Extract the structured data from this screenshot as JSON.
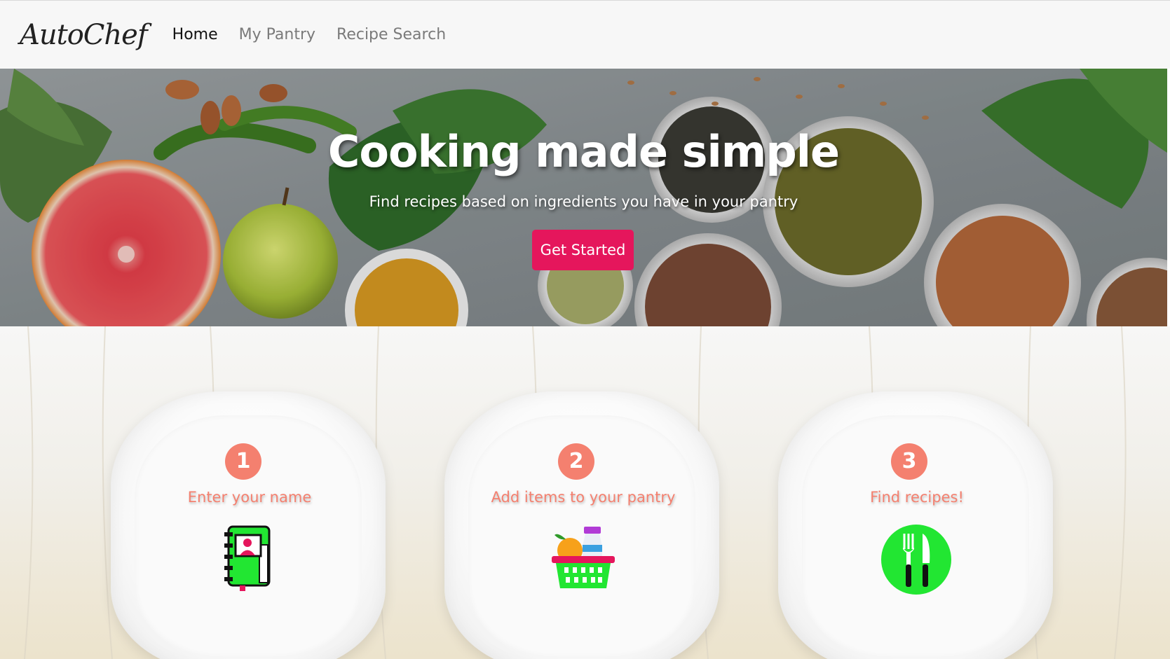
{
  "navbar": {
    "brand": "AutoChef",
    "links": [
      {
        "label": "Home",
        "active": true
      },
      {
        "label": "My Pantry",
        "active": false
      },
      {
        "label": "Recipe Search",
        "active": false
      }
    ]
  },
  "hero": {
    "title": "Cooking made simple",
    "subtitle": "Find recipes based on ingredients you have in your pantry",
    "button_label": "Get Started",
    "button_color": "#e5165c"
  },
  "steps": [
    {
      "number": "1",
      "label": "Enter your name",
      "icon": "address-book-icon"
    },
    {
      "number": "2",
      "label": "Add items to your pantry",
      "icon": "grocery-basket-icon"
    },
    {
      "number": "3",
      "label": "Find recipes!",
      "icon": "fork-knife-icon"
    }
  ],
  "colors": {
    "accent": "#f4806f",
    "icon_green": "#22e632"
  }
}
